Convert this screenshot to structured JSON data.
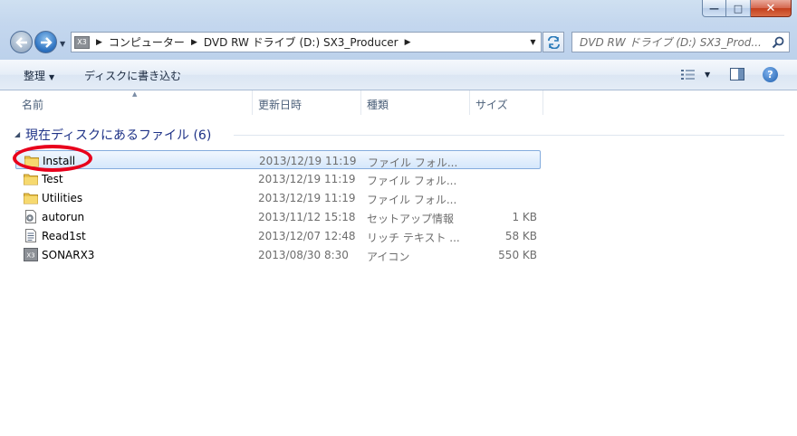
{
  "window": {
    "minimize_label": "—",
    "maximize_label": "□",
    "close_label": "✕"
  },
  "address": {
    "drive_badge": "X3",
    "crumbs": [
      "コンピューター",
      "DVD RW ドライブ (D:) SX3_Producer"
    ],
    "separator": "▶",
    "dropdown": "▼"
  },
  "search": {
    "placeholder": "DVD RW ドライブ (D:) SX3_Prod..."
  },
  "commands": {
    "organize": "整理",
    "organize_arrow": "▼",
    "burn": "ディスクに書き込む",
    "view_arrow": "▼",
    "help": "?"
  },
  "columns": {
    "name": "名前",
    "date": "更新日時",
    "type": "種類",
    "size": "サイズ",
    "sort_caret": "▲"
  },
  "group": {
    "toggle": "◢",
    "title": "現在ディスクにあるファイル (6)"
  },
  "files": [
    {
      "name": "Install",
      "date": "2013/12/19 11:19",
      "type": "ファイル フォル...",
      "size": "",
      "icon": "folder-icon",
      "selected": true
    },
    {
      "name": "Test",
      "date": "2013/12/19 11:19",
      "type": "ファイル フォル...",
      "size": "",
      "icon": "folder-icon",
      "selected": false
    },
    {
      "name": "Utilities",
      "date": "2013/12/19 11:19",
      "type": "ファイル フォル...",
      "size": "",
      "icon": "folder-icon",
      "selected": false
    },
    {
      "name": "autorun",
      "date": "2013/11/12 15:18",
      "type": "セットアップ情報",
      "size": "1 KB",
      "icon": "setup-info-icon",
      "selected": false
    },
    {
      "name": "Read1st",
      "date": "2013/12/07 12:48",
      "type": "リッチ テキスト ...",
      "size": "58 KB",
      "icon": "rich-text-icon",
      "selected": false
    },
    {
      "name": "SONARX3",
      "date": "2013/08/30 8:30",
      "type": "アイコン",
      "size": "550 KB",
      "icon": "sonar-icon",
      "selected": false
    }
  ],
  "sonar_badge": "X3",
  "colors": {
    "highlight_annotation": "#e8001c",
    "group_title": "#1e3287",
    "selection_border": "#84acdd"
  }
}
